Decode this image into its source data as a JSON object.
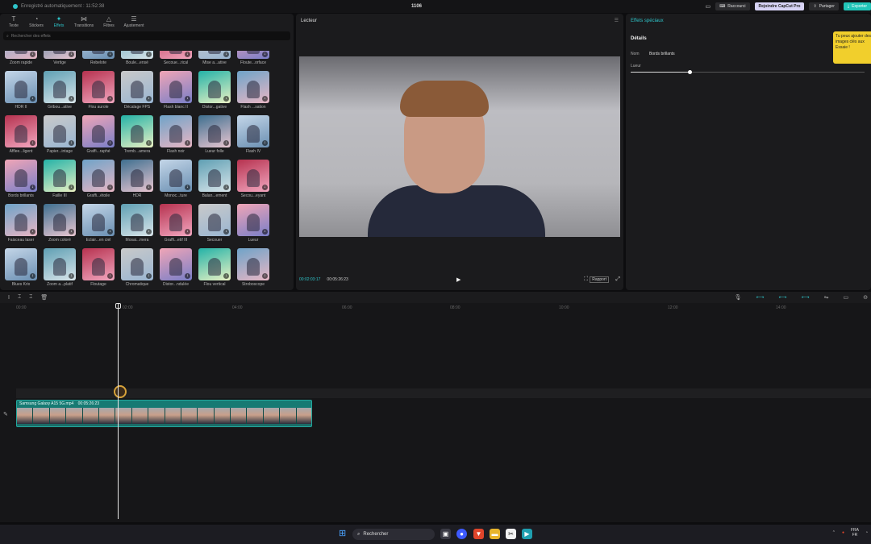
{
  "topbar": {
    "save_status": "Enregistré automatiquement : 11:52:38",
    "project_name": "1106",
    "shortcuts_label": "Raccourci",
    "pro_label": "Rejoindre CapCut Pro",
    "share_label": "Partager",
    "export_label": "Exporter"
  },
  "left": {
    "tabs": [
      {
        "label": "Texte",
        "icon": "text-icon"
      },
      {
        "label": "Stickers",
        "icon": "sticker-icon"
      },
      {
        "label": "Effets",
        "icon": "effects-icon"
      },
      {
        "label": "Transitions",
        "icon": "transitions-icon"
      },
      {
        "label": "Filtres",
        "icon": "filters-icon"
      },
      {
        "label": "Ajustement",
        "icon": "adjust-icon"
      }
    ],
    "search_placeholder": "Rechercher des effets",
    "effects": [
      "Zoom rapide",
      "Vertige",
      "Rebelote",
      "Boule...ensé",
      "Secoue...rical",
      "Mise a...ative",
      "Floute...orface",
      "HDR II",
      "Gribou...ative",
      "Flou aurole",
      "Décalage FPS",
      "Flash blanc II",
      "Distor...gative",
      "Flash ...sation",
      "Afflee...ligent",
      "Papier...intage",
      "Graffi...raphé",
      "Tremb...amera",
      "Flash noir",
      "Lueur folle",
      "Flash IV",
      "Bords brillants",
      "Faille III",
      "Graffi...étoile",
      "HDR",
      "Monoc...ture",
      "Balan...ement",
      "Secou...eyant",
      "Faisceau laser",
      "Zoom coloré",
      "Eclair...en ciel",
      "Mosai...mera",
      "Graffi...etif III",
      "Secouer",
      "Lueur",
      "Blues Krix",
      "Zoom a...platif",
      "Floutage",
      "Chromatique",
      "Distor...ndulée",
      "Flou vertical",
      "Stroboscope"
    ]
  },
  "player": {
    "title": "Lecteur",
    "current_time": "00:02:03:17",
    "total_time": "00:05:26:23",
    "ratio_label": "Rapport"
  },
  "right": {
    "title": "Effets spéciaux",
    "section": "Détails",
    "name_label": "Nom",
    "name_value": "Bords brillants",
    "glow_label": "Lueur",
    "glow_value": 0.25,
    "tooltip": "Tu peux ajouter des images clés aux Essaie !"
  },
  "timeline": {
    "ruler_marks": [
      "00:00",
      "02:00",
      "04:00",
      "06:00",
      "08:00",
      "10:00",
      "12:00",
      "14:00"
    ],
    "clip_name": "Samsung Galaxy A15 5G.mp4",
    "clip_duration": "00:05:26:23"
  },
  "taskbar": {
    "search_label": "Rechercher",
    "lang_line1": "FRA",
    "lang_line2": "FR"
  },
  "colors": {
    "accent": "#2ec4c9",
    "tooltip": "#f1cf2c",
    "clip": "#1b6b66"
  }
}
